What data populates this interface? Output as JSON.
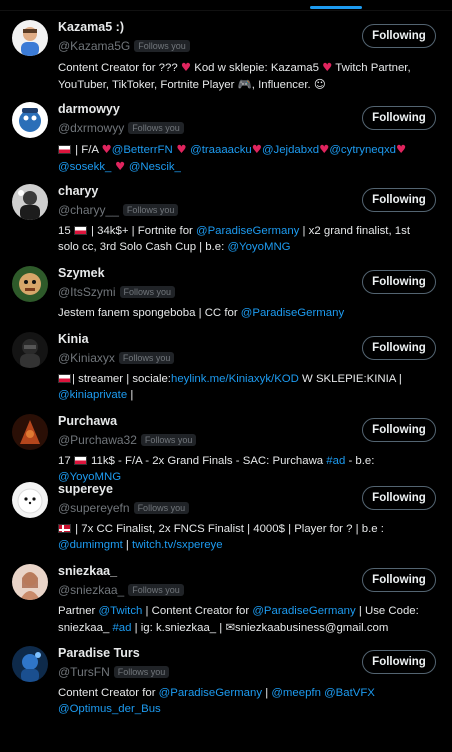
{
  "users": [
    {
      "name": "Kazama5 :)",
      "handle": "@Kazama5G",
      "badge": "Follows you",
      "button": "Following",
      "bio": [
        {
          "t": "Content Creator for ??? "
        },
        {
          "t": "♥",
          "c": "heart"
        },
        {
          "t": " Kod w sklepie: Kazama5 "
        },
        {
          "t": "♥",
          "c": "heart"
        },
        {
          "t": " Twitch Partner, YouTuber, TikToker, Fortnite Player 🎮, Influencer. "
        },
        {
          "t": "☺",
          "c": "emoji"
        }
      ]
    },
    {
      "name": "darmowyy",
      "handle": "@dxrmowyy",
      "badge": "Follows you",
      "button": "Following",
      "bio": [
        {
          "flag": "pl"
        },
        {
          "t": " | F/A "
        },
        {
          "t": "♥",
          "c": "heart"
        },
        {
          "t": "@BetterrFN",
          "c": "mention"
        },
        {
          "t": " ♥ ",
          "c": "heart"
        },
        {
          "t": "@traaaacku",
          "c": "mention"
        },
        {
          "t": "♥",
          "c": "heart"
        },
        {
          "t": "@Jejdabxd",
          "c": "mention"
        },
        {
          "t": "♥",
          "c": "heart"
        },
        {
          "t": "@cytryneqxd",
          "c": "mention"
        },
        {
          "t": "♥",
          "c": "heart"
        },
        {
          "t": " "
        },
        {
          "t": "@sosekk_",
          "c": "mention"
        },
        {
          "t": " ♥ ",
          "c": "heart"
        },
        {
          "t": "@Nescik_",
          "c": "mention"
        }
      ]
    },
    {
      "name": "charyy",
      "handle": "@charyy__",
      "badge": "Follows you",
      "button": "Following",
      "bio": [
        {
          "t": "15 "
        },
        {
          "flag": "pl"
        },
        {
          "t": " | 34k$+ | Fortnite for "
        },
        {
          "t": "@ParadiseGermany",
          "c": "mention"
        },
        {
          "t": " | x2 grand finalist, 1st solo cc, 3rd Solo Cash Cup | b.e: "
        },
        {
          "t": "@YoyoMNG",
          "c": "mention"
        }
      ]
    },
    {
      "name": "Szymek",
      "handle": "@ItsSzymi",
      "badge": "Follows you",
      "button": "Following",
      "bio": [
        {
          "t": "Jestem fanem spongeboba | CC for "
        },
        {
          "t": "@ParadiseGermany",
          "c": "mention"
        }
      ]
    },
    {
      "name": "Kinia",
      "handle": "@Kiniaxyx",
      "badge": "Follows you",
      "button": "Following",
      "bio": [
        {
          "flag": "pl"
        },
        {
          "t": "| streamer | sociale:"
        },
        {
          "t": "heylink.me/Kiniaxyk/",
          "c": "mention"
        },
        {
          "t": "KOD",
          "c": "mention"
        },
        {
          "t": " W SKLEPIE:KINIA | "
        },
        {
          "t": "@kiniaprivate",
          "c": "mention"
        },
        {
          "t": " |"
        }
      ]
    },
    {
      "name": "Purchawa",
      "handle": "@Purchawa32",
      "badge": "Follows you",
      "button": "Following",
      "bio": [
        {
          "t": "17 "
        },
        {
          "flag": "pl"
        },
        {
          "t": " 11k$ - F/A - 2x Grand Finals - SAC: Purchawa "
        },
        {
          "t": "#ad",
          "c": "mention"
        },
        {
          "t": " - b.e: "
        },
        {
          "t": "@YoyoMNG",
          "c": "mention"
        }
      ]
    },
    {
      "name": "supereye",
      "handle": "@supereyefn",
      "badge": "Follows you",
      "button": "Following",
      "bio": [
        {
          "flag": "dk"
        },
        {
          "t": " | 7x CC Finalist, 2x FNCS Finalist | 4000$ | Player for ? | b.e : "
        },
        {
          "t": "@dumimgmt",
          "c": "mention"
        },
        {
          "t": " | "
        },
        {
          "t": "twitch.tv/sxpereye",
          "c": "mention"
        }
      ]
    },
    {
      "name": "sniezkaa_",
      "handle": "@sniezkaa_",
      "badge": "Follows you",
      "button": "Following",
      "bio": [
        {
          "t": "Partner "
        },
        {
          "t": "@Twitch",
          "c": "mention"
        },
        {
          "t": " | Content Creator for "
        },
        {
          "t": "@ParadiseGermany",
          "c": "mention"
        },
        {
          "t": " | Use Code: sniezkaa_ "
        },
        {
          "t": "#ad",
          "c": "mention"
        },
        {
          "t": " | ig: k.sniezkaa_ | "
        },
        {
          "t": "✉",
          "c": "emoji"
        },
        {
          "t": "sniezkaabusiness@gmail.com"
        }
      ]
    },
    {
      "name": "Paradise Turs",
      "handle": "@TursFN",
      "badge": "Follows you",
      "button": "Following",
      "bio": [
        {
          "t": "Content Creator for "
        },
        {
          "t": "@ParadiseGermany",
          "c": "mention"
        },
        {
          "t": " | "
        },
        {
          "t": "@meepfn",
          "c": "mention"
        },
        {
          "t": " "
        },
        {
          "t": "@BatVFX",
          "c": "mention"
        },
        {
          "t": " "
        },
        {
          "t": "@Optimus_der_Bus",
          "c": "mention"
        }
      ]
    }
  ],
  "colors": {
    "accent": "#1d9bf0",
    "background": "#000000",
    "text": "#e7e9ea",
    "muted": "#71767b"
  }
}
